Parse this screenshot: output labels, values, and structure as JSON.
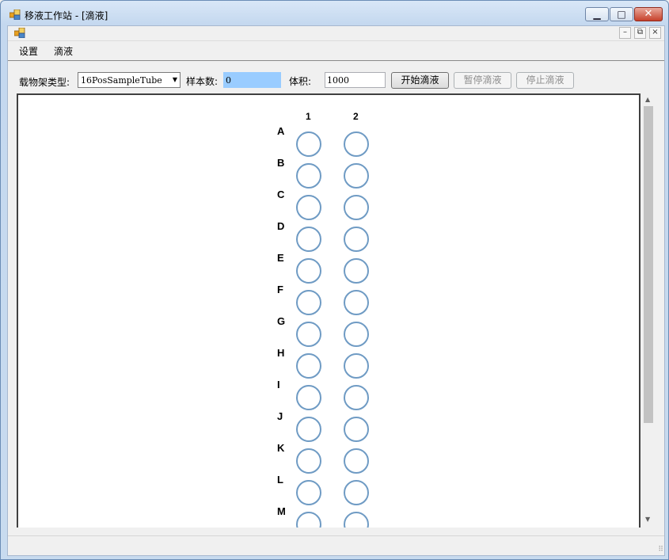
{
  "window": {
    "title": "移液工作站 - [滴液]",
    "minimize_glyph": "▁",
    "maximize_glyph": "□",
    "close_glyph": "✕"
  },
  "mdi_controls": {
    "minimize": "–",
    "restore": "⧉",
    "close": "×"
  },
  "menu": {
    "items": [
      "设置",
      "滴液"
    ]
  },
  "toolbar": {
    "carrier_type_label": "载物架类型:",
    "carrier_type_value": "16PosSampleTube",
    "sample_count_label": "样本数:",
    "sample_count_value": "0",
    "volume_label": "体积:",
    "volume_value": "1000",
    "start_button": "开始滴液",
    "pause_button": "暂停滴液",
    "stop_button": "停止滴液"
  },
  "plate": {
    "columns": [
      "1",
      "2"
    ],
    "rows": [
      "A",
      "B",
      "C",
      "D",
      "E",
      "F",
      "G",
      "H",
      "I",
      "J",
      "K",
      "L",
      "M"
    ]
  },
  "colors": {
    "well_border": "#6f9bc4",
    "panel_background": "#ffffff"
  }
}
